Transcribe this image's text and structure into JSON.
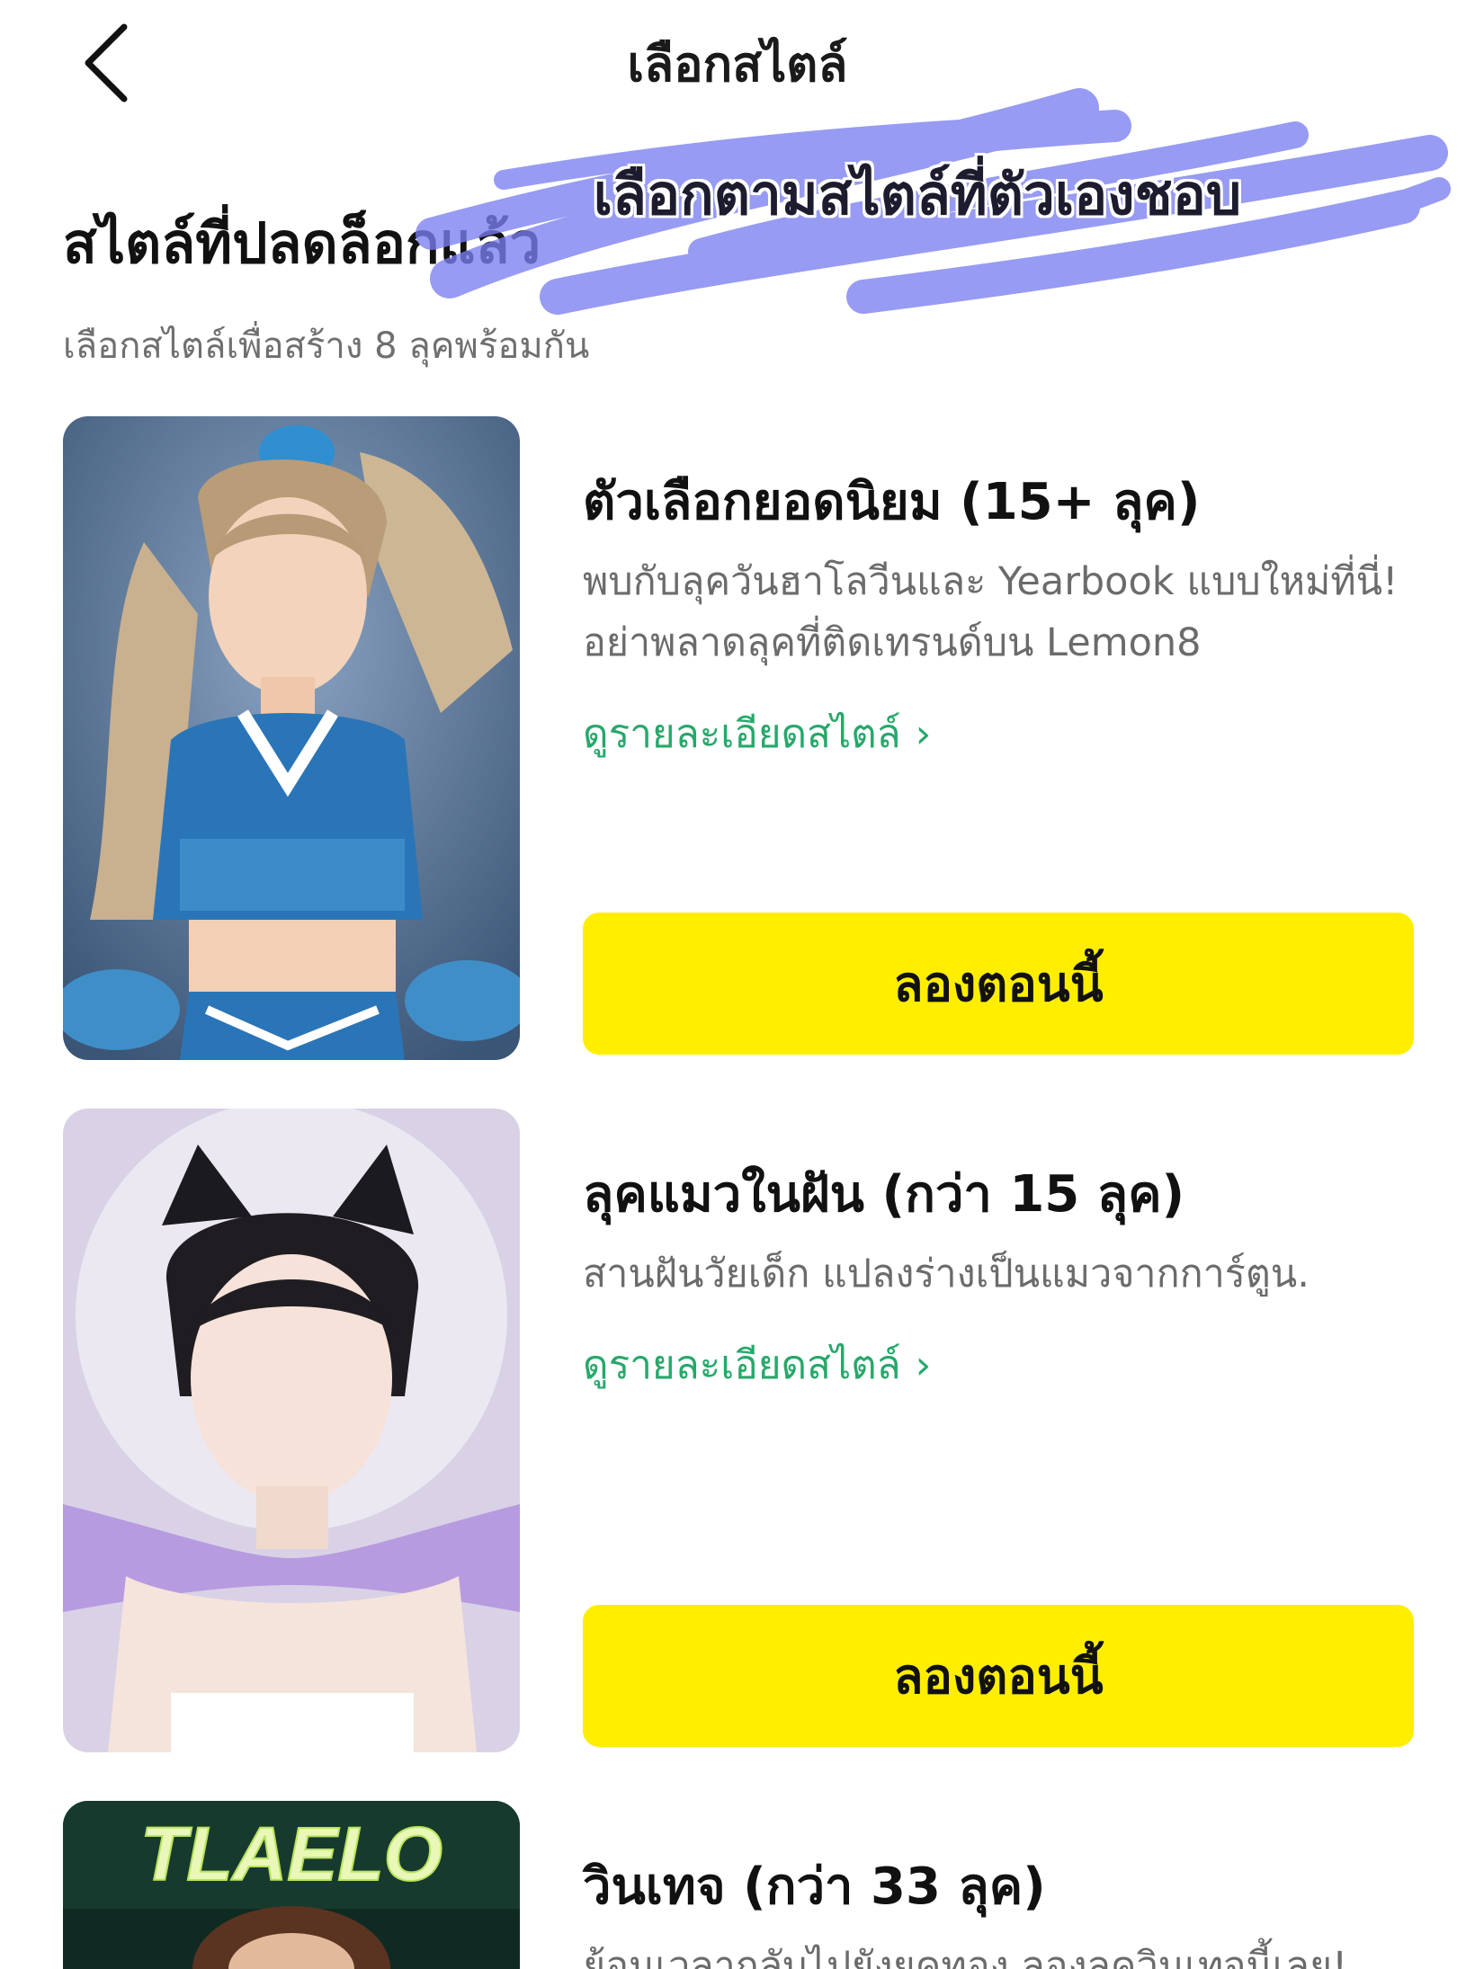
{
  "header": {
    "back_icon": "chevron-left-icon",
    "title": "เลือกสไตล์"
  },
  "overlay": {
    "text": "เลือกตามสไตล์ที่ตัวเองชอบ",
    "scribble_color": "#7b7ff0"
  },
  "section": {
    "title": "สไตล์ที่ปลดล็อกแล้ว",
    "subtitle": "เลือกสไตล์เพื่อสร้าง 8 ลุคพร้อมกัน"
  },
  "cards": [
    {
      "image": "cheerleader-portrait",
      "title": "ตัวเลือกยอดนิยม (15+ ลุค)",
      "description": "พบกับลุควันฮาโลวีนและ Yearbook แบบใหม่ที่นี่! อย่าพลาดลุคที่ติดเทรนด์บน Lemon8",
      "link_label": "ดูรายละเอียดสไตล์",
      "button_label": "ลองตอนนี้"
    },
    {
      "image": "cat-ear-portrait",
      "title": "ลุคแมวในฝัน (กว่า 15 ลุค)",
      "description": "สานฝันวัยเด็ก แปลงร่างเป็นแมวจากการ์ตูน.",
      "link_label": "ดูรายละเอียดสไตล์",
      "button_label": "ลองตอนนี้"
    },
    {
      "image": "vintage-neon-portrait",
      "image_sign_text": "TLAELO",
      "title": "วินเทจ (กว่า 33 ลุค)",
      "description": "ย้อนเวลากลับไปยังยุคทอง ลองลุควินเทจนี้เลย!"
    }
  ],
  "colors": {
    "accent_yellow": "#ffee00",
    "link_green": "#27a86b",
    "subtitle_gray": "#6f6f6f"
  }
}
